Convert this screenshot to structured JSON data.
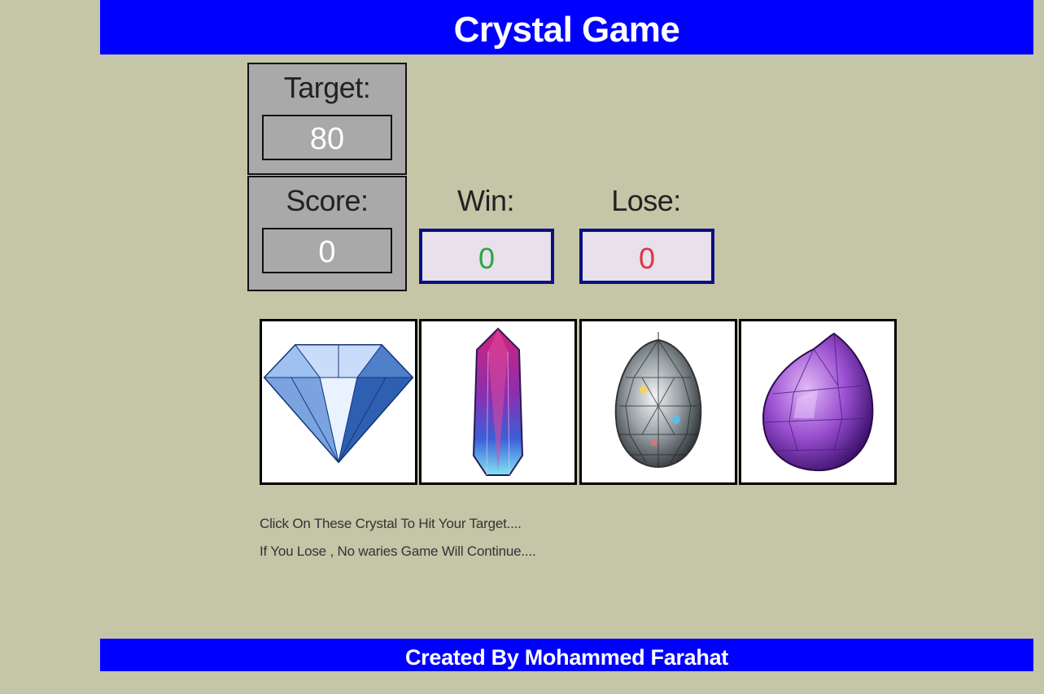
{
  "header": {
    "title": "Crystal Game"
  },
  "target": {
    "label": "Target:",
    "value": "80"
  },
  "score": {
    "label": "Score:",
    "value": "0"
  },
  "win": {
    "label": "Win:",
    "value": "0",
    "color": "#28a745"
  },
  "lose": {
    "label": "Lose:",
    "value": "0",
    "color": "#dc3545"
  },
  "crystals": [
    {
      "icon": "diamond-crystal-icon"
    },
    {
      "icon": "pink-blue-crystal-icon"
    },
    {
      "icon": "clear-teardrop-crystal-icon"
    },
    {
      "icon": "purple-crystal-icon"
    }
  ],
  "instructions": {
    "line1": "Click On These Crystal To Hit Your Target....",
    "line2": "If You Lose , No waries Game Will Continue...."
  },
  "footer": {
    "text": "Created By Mohammed Farahat"
  },
  "colors": {
    "background": "#c5c5a7",
    "banner": "#0000ff",
    "stat_box": "#a9a9a9"
  }
}
